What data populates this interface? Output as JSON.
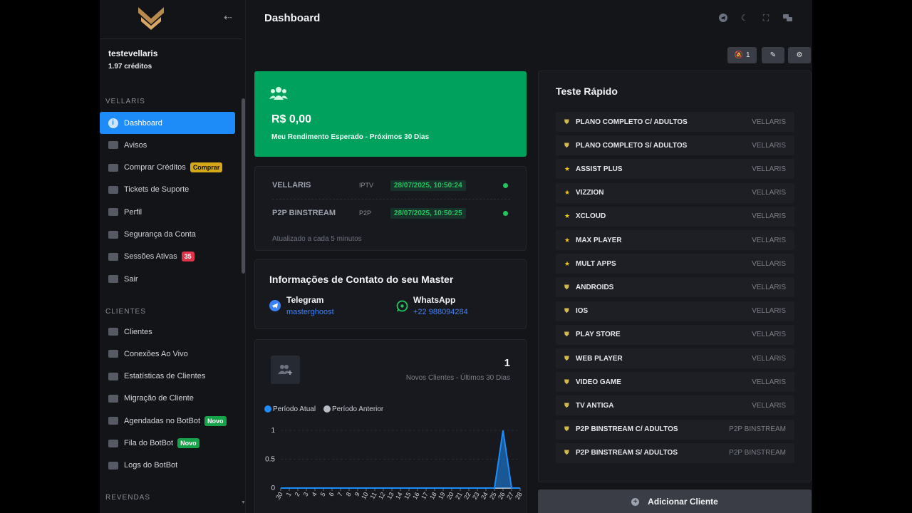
{
  "sidebar": {
    "username": "testevellaris",
    "credits": "1.97 créditos",
    "sections": {
      "vellaris": "VELLARIS",
      "clientes": "CLIENTES",
      "revendas": "REVENDAS"
    },
    "items": [
      {
        "label": "Dashboard",
        "icon": "info-icon"
      },
      {
        "label": "Avisos",
        "icon": "flag-icon"
      },
      {
        "label": "Comprar Créditos",
        "icon": "dollar-icon",
        "badge": "Comprar"
      },
      {
        "label": "Tickets de Suporte",
        "icon": "chat-icon"
      },
      {
        "label": "Perfil",
        "icon": "user-icon"
      },
      {
        "label": "Segurança da Conta",
        "icon": "lock-icon"
      },
      {
        "label": "Sessões Ativas",
        "icon": "shield-icon",
        "badge": "35"
      },
      {
        "label": "Sair",
        "icon": "logout-icon"
      }
    ],
    "client_items": [
      {
        "label": "Clientes",
        "icon": "users-icon"
      },
      {
        "label": "Conexões Ao Vivo",
        "icon": "monitor-icon"
      },
      {
        "label": "Estatísticas de Clientes",
        "icon": "stats-icon"
      },
      {
        "label": "Migração de Cliente",
        "icon": "migrate-icon"
      },
      {
        "label": "Agendadas no BotBot",
        "icon": "calendar-icon",
        "badge": "Novo"
      },
      {
        "label": "Fila do BotBot",
        "icon": "queue-icon",
        "badge": "Novo"
      },
      {
        "label": "Logs do BotBot",
        "icon": "mail-icon"
      }
    ]
  },
  "header": {
    "title": "Dashboard",
    "notif_count": "1"
  },
  "earnings": {
    "amount": "R$ 0,00",
    "description": "Meu Rendimento Esperado - Próximos 30 Dias"
  },
  "servers": {
    "rows": [
      {
        "name": "VELLARIS",
        "type": "IPTV",
        "date": "28/07/2025, 10:50:24"
      },
      {
        "name": "P2P BINSTREAM",
        "type": "P2P",
        "date": "28/07/2025, 10:50:25"
      }
    ],
    "footer": "Atualizado a cada 5 minutos"
  },
  "contact": {
    "title": "Informações de Contato do seu Master",
    "telegram_label": "Telegram",
    "telegram_value": "masterghoost",
    "whatsapp_label": "WhatsApp",
    "whatsapp_value": "+22 988094284"
  },
  "new_clients": {
    "count": "1",
    "label": "Novos Clientes - Últimos 30 Dias"
  },
  "chart_data": {
    "type": "area",
    "legend": [
      "Período Atual",
      "Período Anterior"
    ],
    "x": [
      "30",
      "1",
      "2",
      "3",
      "4",
      "5",
      "6",
      "7",
      "8",
      "9",
      "10",
      "11",
      "12",
      "13",
      "14",
      "15",
      "16",
      "17",
      "18",
      "19",
      "20",
      "21",
      "22",
      "23",
      "24",
      "25",
      "26",
      "27",
      "28"
    ],
    "series": [
      {
        "name": "Período Atual",
        "values": [
          0,
          0,
          0,
          0,
          0,
          0,
          0,
          0,
          0,
          0,
          0,
          0,
          0,
          0,
          0,
          0,
          0,
          0,
          0,
          0,
          0,
          0,
          0,
          0,
          0,
          0,
          1,
          0,
          0
        ],
        "color": "#1d8cf8"
      },
      {
        "name": "Período Anterior",
        "values": [
          0,
          0,
          0,
          0,
          0,
          0,
          0,
          0,
          0,
          0,
          0,
          0,
          0,
          0,
          0,
          0,
          0,
          0,
          0,
          0,
          0,
          0,
          0,
          0,
          0,
          0,
          0,
          0,
          0
        ],
        "color": "#b8bcc6"
      }
    ],
    "yticks": [
      "0",
      "0.5",
      "1"
    ],
    "ylim": [
      0,
      1
    ]
  },
  "quick_test": {
    "title": "Teste Rápido",
    "items": [
      {
        "name": "PLANO COMPLETO C/ ADULTOS",
        "server": "VELLARIS",
        "icon": "shield-icon"
      },
      {
        "name": "PLANO COMPLETO S/ ADULTOS",
        "server": "VELLARIS",
        "icon": "shield-icon"
      },
      {
        "name": "ASSIST PLUS",
        "server": "VELLARIS",
        "icon": "star-icon"
      },
      {
        "name": "VIZZION",
        "server": "VELLARIS",
        "icon": "star-icon"
      },
      {
        "name": "XCLOUD",
        "server": "VELLARIS",
        "icon": "star-icon"
      },
      {
        "name": "MAX PLAYER",
        "server": "VELLARIS",
        "icon": "star-icon"
      },
      {
        "name": "MULT APPS",
        "server": "VELLARIS",
        "icon": "star-icon"
      },
      {
        "name": "ANDROIDS",
        "server": "VELLARIS",
        "icon": "shield-icon"
      },
      {
        "name": "IOS",
        "server": "VELLARIS",
        "icon": "shield-icon"
      },
      {
        "name": "PLAY STORE",
        "server": "VELLARIS",
        "icon": "shield-icon"
      },
      {
        "name": "WEB PLAYER",
        "server": "VELLARIS",
        "icon": "shield-icon"
      },
      {
        "name": "VIDEO GAME",
        "server": "VELLARIS",
        "icon": "shield-icon"
      },
      {
        "name": "TV ANTIGA",
        "server": "VELLARIS",
        "icon": "shield-icon"
      },
      {
        "name": "P2P BINSTREAM C/ ADULTOS",
        "server": "P2P BINSTREAM",
        "icon": "shield-icon"
      },
      {
        "name": "P2P BINSTREAM S/ ADULTOS",
        "server": "P2P BINSTREAM",
        "icon": "shield-icon"
      }
    ]
  },
  "add_client_label": "Adicionar Cliente",
  "colors": {
    "accent": "#1d8cf8",
    "success": "#00a15c",
    "background": "#141519"
  }
}
